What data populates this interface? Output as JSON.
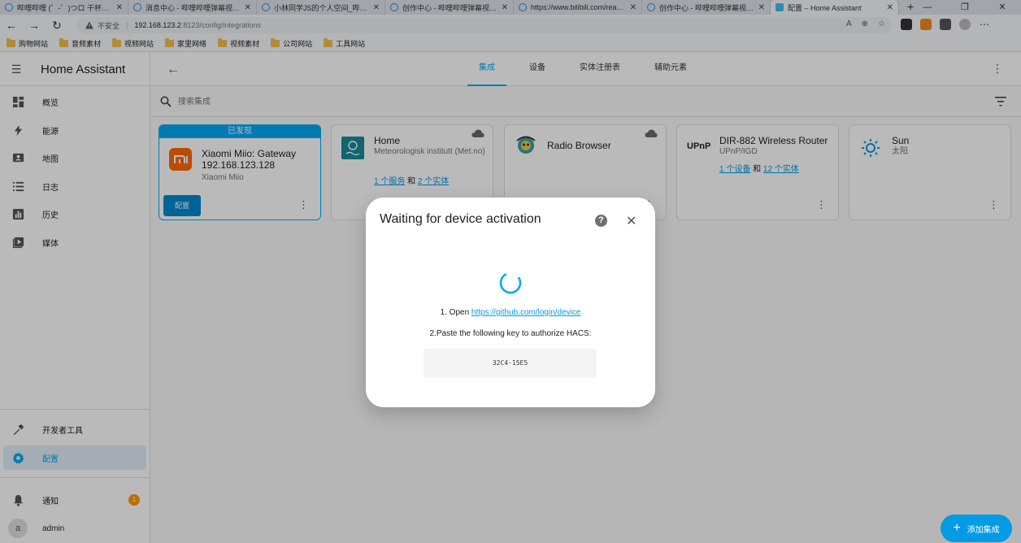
{
  "browser": {
    "tabs": [
      {
        "title": "哔哩哔哩 (゜-゜)つロ 干杯~-bili",
        "icon": "bilibili-icon",
        "active": false
      },
      {
        "title": "消息中心 - 哔哩哔哩弹幕视频网",
        "icon": "bilibili-icon",
        "active": false
      },
      {
        "title": "小林同学JS的个人空间_哔哩哔哩",
        "icon": "bilibili-icon",
        "active": false
      },
      {
        "title": "创作中心 - 哔哩哔哩弹幕视频网",
        "icon": "bilibili-icon",
        "active": false
      },
      {
        "title": "https://www.bilibili.com/read/pr",
        "icon": "bilibili-icon",
        "active": false
      },
      {
        "title": "创作中心 - 哔哩哔哩弹幕视频网",
        "icon": "bilibili-icon",
        "active": false
      },
      {
        "title": "配置 – Home Assistant",
        "icon": "home-assistant-icon",
        "active": true
      }
    ],
    "insecure_label": "不安全",
    "url_host": "192.168.123.2",
    "url_path": ":8123/config/integrations",
    "bookmarks": [
      "购物网站",
      "音频素材",
      "视频网站",
      "家里网络",
      "视频素材",
      "公司网站",
      "工具网站"
    ]
  },
  "sidebar": {
    "title": "Home Assistant",
    "items": [
      {
        "label": "概览",
        "icon": "dashboard-icon"
      },
      {
        "label": "能源",
        "icon": "lightning-icon"
      },
      {
        "label": "地图",
        "icon": "map-icon"
      },
      {
        "label": "日志",
        "icon": "list-icon"
      },
      {
        "label": "历史",
        "icon": "chart-icon"
      },
      {
        "label": "媒体",
        "icon": "media-icon"
      }
    ],
    "dev_tools": "开发者工具",
    "config": "配置",
    "notifications": "通知",
    "notification_count": "1",
    "user_initial": "a",
    "user_name": "admin"
  },
  "header": {
    "tabs": [
      "集成",
      "设备",
      "实体注册表",
      "辅助元素"
    ],
    "active_tab": "集成"
  },
  "search": {
    "placeholder": "搜索集成"
  },
  "cards": {
    "xiaomi": {
      "discovered_label": "已发现",
      "name": "Xiaomi Miio: Gateway 192.168.123.128",
      "sub": "Xiaomi Miio",
      "button": "配置"
    },
    "home": {
      "name": "Home",
      "sub": "Meteorologisk institutt (Met.no)",
      "link1": "1 个服务",
      "and": "和",
      "link2": "2 个实体"
    },
    "radio": {
      "name": "Radio Browser"
    },
    "upnp": {
      "logo_text": "UPnP",
      "name": "DIR-882 Wireless Router",
      "sub": "UPnP/IGD",
      "link1": "1 个设备",
      "and": "和",
      "link2": "12 个实体"
    },
    "sun": {
      "name": "Sun",
      "sub": "太阳"
    }
  },
  "fab": {
    "label": "添加集成"
  },
  "dialog": {
    "title": "Waiting for device activation",
    "step1_prefix": "1.  Open",
    "step1_link": "https://github.com/login/device",
    "step2": "2.Paste the following key to authorize HACS:",
    "code": "32C4-15E5"
  },
  "colors": {
    "primary": "#03a9f4",
    "fab": "#039be5",
    "badge": "#ff9800",
    "xiaomi_orange": "#ff6900",
    "met_teal": "#1a8a9a"
  }
}
